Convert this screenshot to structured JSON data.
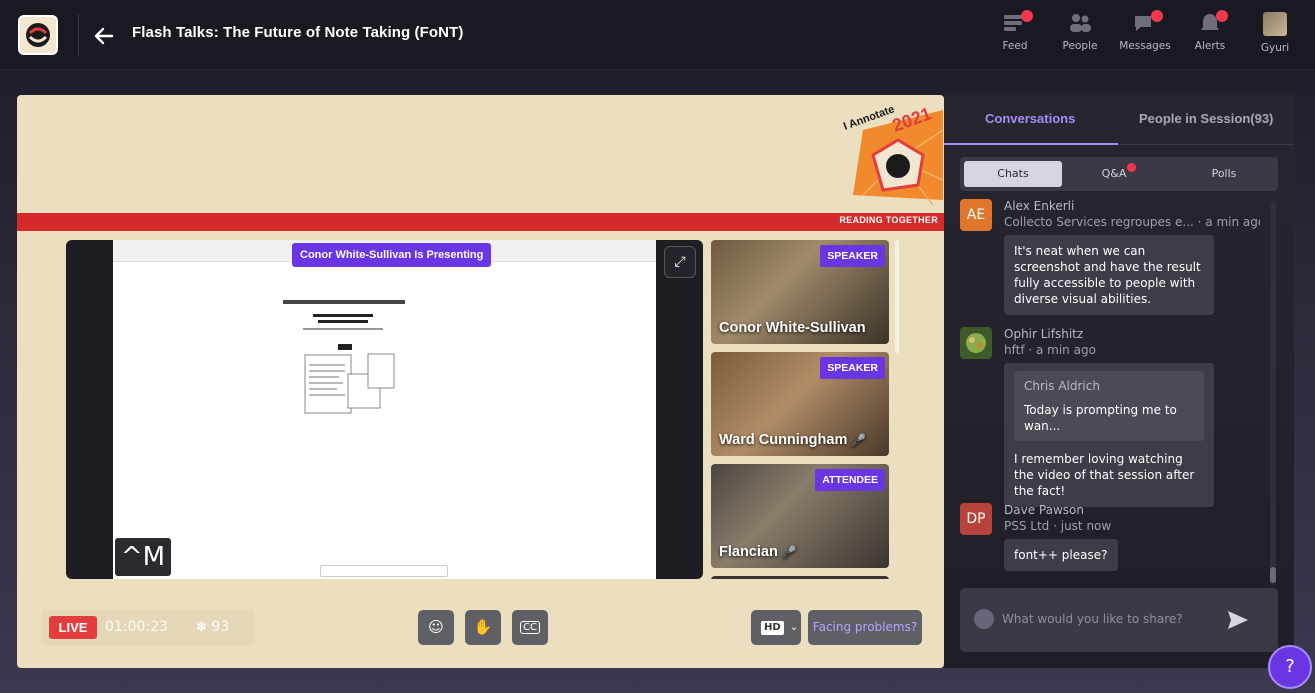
{
  "header": {
    "title": "Flash Talks: The Future of Note Taking (FoNT)",
    "nav": [
      {
        "label": "Feed",
        "icon": "feed-icon",
        "badge": true
      },
      {
        "label": "People",
        "icon": "people-icon",
        "badge": false
      },
      {
        "label": "Messages",
        "icon": "messages-icon",
        "badge": true
      },
      {
        "label": "Alerts",
        "icon": "bell-icon",
        "badge": true
      },
      {
        "label": "Gyuri",
        "icon": "user-avatar",
        "badge": false
      }
    ]
  },
  "stage": {
    "banner_text": "READING TOGETHER",
    "banner_badge_year": "2021",
    "banner_badge_title": "I Annotate",
    "presenting_label": "Conor White-Sullivan Is Presenting",
    "overlay_key": "^M"
  },
  "speakers": [
    {
      "name": "Conor White-Sullivan",
      "role": "SPEAKER",
      "muted": false
    },
    {
      "name": "Ward Cunningham",
      "role": "SPEAKER",
      "muted": true
    },
    {
      "name": "Flancian",
      "role": "ATTENDEE",
      "muted": true
    }
  ],
  "controls": {
    "live_label": "LIVE",
    "timer": "01:00:23",
    "viewer_count": "93",
    "quality_label": "HD",
    "facing_problems": "Facing problems?"
  },
  "panel": {
    "tabs": [
      "Conversations",
      "People in Session(93)"
    ],
    "subtabs": [
      "Chats",
      "Q&A",
      "Polls"
    ],
    "messages": [
      {
        "initials": "AE",
        "avatar_color": "#e0762b",
        "name": "Alex Enkerli",
        "meta": "Collecto Services regroupes e... · a min ago",
        "text": "It's neat when we can screenshot and have the result fully accessible to people with diverse visual abilities."
      },
      {
        "initials": "",
        "avatar_color": "#6a8a3a",
        "name": "Ophir Lifshitz",
        "meta": "hftf · a min ago",
        "quote_name": "Chris Aldrich",
        "quote_text": "Today is prompting me to wan...",
        "text": "I remember loving watching the video of that session after the fact!"
      },
      {
        "initials": "DP",
        "avatar_color": "#b8433a",
        "name": "Dave Pawson",
        "meta": "PSS Ltd · just now",
        "text": "font++ please?"
      }
    ],
    "composer_placeholder": "What would you like to share?"
  },
  "colors": {
    "accent": "#6a36e4",
    "live": "#e43d3d",
    "stage_bg": "#ecdfc0",
    "banner_red": "#d42a2a"
  }
}
